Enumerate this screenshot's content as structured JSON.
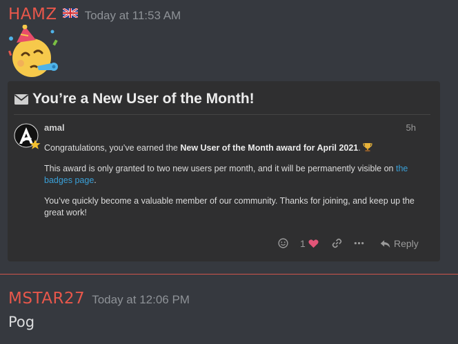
{
  "messages": [
    {
      "author": "HAMZ",
      "timestamp": "Today at 11:53 AM"
    },
    {
      "author": "MSTAR27",
      "timestamp": "Today at 12:06 PM",
      "text": "Pog"
    }
  ],
  "embed": {
    "title": "You’re a New User of the Month!",
    "poster": "amal",
    "age": "5h",
    "p1_prefix": "Congratulations, you’ve earned the ",
    "p1_bold": "New User of the Month award for April 2021",
    "p1_suffix": ".",
    "p2_prefix": "This award is only granted to two new users per month, and it will be permanently visible on ",
    "p2_link": "the badges page",
    "p2_suffix": ".",
    "p3": "You’ve quickly become a valuable member of our community. Thanks for joining, and keep up the great work!",
    "like_count": "1",
    "reply_label": "Reply"
  },
  "colors": {
    "background": "#36393f",
    "author": "#e8574b",
    "card": "#2f2f30",
    "link": "#3aa0d8",
    "heart": "#e25577",
    "divider": "#d2544c"
  },
  "icons": [
    "uk-flag-icon",
    "partying-face-emoji",
    "envelope-icon",
    "trophy-icon",
    "smiley-icon",
    "heart-icon",
    "link-icon",
    "more-icon",
    "reply-icon"
  ]
}
